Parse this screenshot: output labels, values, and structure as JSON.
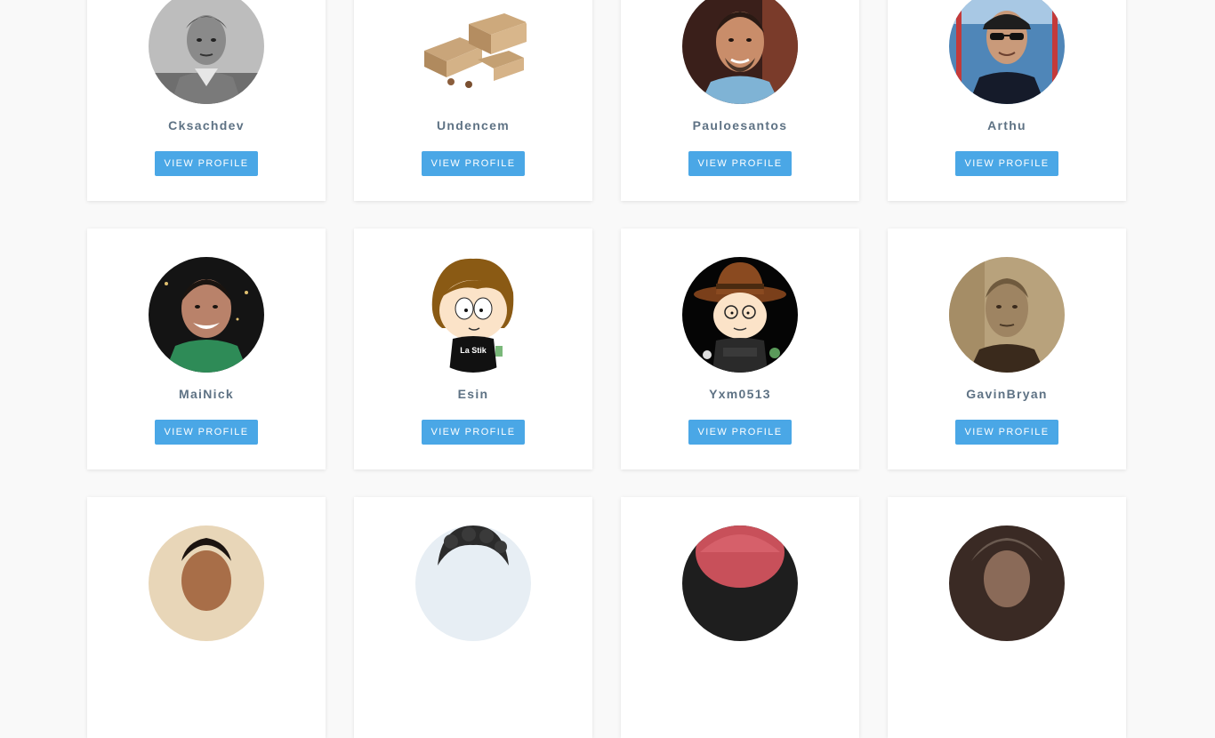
{
  "profiles": [
    {
      "username": "Cksachdev",
      "button_label": "VIEW PROFILE",
      "avatar": "bw-portrait-man-photo"
    },
    {
      "username": "Undencem",
      "button_label": "VIEW PROFILE",
      "avatar": "cardboard-boxes-photo"
    },
    {
      "username": "Pauloesantos",
      "button_label": "VIEW PROFILE",
      "avatar": "smiling-man-goatee-photo"
    },
    {
      "username": "Arthu",
      "button_label": "VIEW PROFILE",
      "avatar": "man-cap-sunglasses-photo"
    },
    {
      "username": "MaiNick",
      "button_label": "VIEW PROFILE",
      "avatar": "smiling-man-night-photo"
    },
    {
      "username": "Esin",
      "button_label": "VIEW PROFILE",
      "avatar": "cartoon-character-avatar"
    },
    {
      "username": "Yxm0513",
      "button_label": "VIEW PROFILE",
      "avatar": "cartoon-cowboy-hat-avatar"
    },
    {
      "username": "GavinBryan",
      "button_label": "VIEW PROFILE",
      "avatar": "sepia-portrait-man-photo"
    },
    {
      "username": "",
      "button_label": "",
      "avatar": "man-portrait-photo"
    },
    {
      "username": "",
      "button_label": "",
      "avatar": "curly-hair-person-photo"
    },
    {
      "username": "",
      "button_label": "",
      "avatar": "red-portrait-photo"
    },
    {
      "username": "",
      "button_label": "",
      "avatar": "dark-portrait-photo"
    }
  ],
  "colors": {
    "page_background": "#f9f9f9",
    "card_background": "#ffffff",
    "name_text": "#5e7284",
    "button_background": "#4aa7e6",
    "button_text": "#ffffff"
  }
}
